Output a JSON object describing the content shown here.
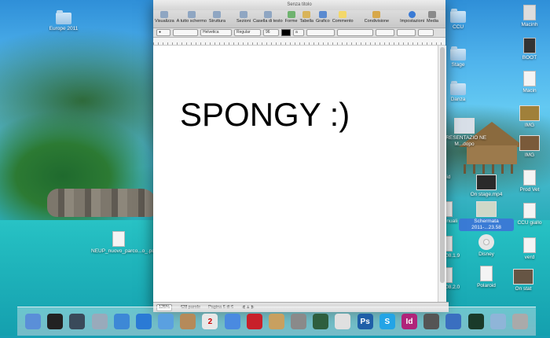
{
  "desktop": {
    "icons_left": [
      {
        "label": "Europe 2011"
      },
      {
        "label": "NEUP_nuovo_parco...o_.pdf"
      }
    ],
    "icons_right": [
      {
        "label": "CCU"
      },
      {
        "label": "Stage"
      },
      {
        "label": "Danza"
      },
      {
        "label": "PRESENTAZIO NE M...dopo"
      },
      {
        "label": "On stage.mp4"
      },
      {
        "label": "Schermata 2011-...23.58"
      },
      {
        "label": "Disney"
      },
      {
        "label": "Polaroid"
      },
      {
        "label": "On stat"
      },
      {
        "label": "Macinh"
      },
      {
        "label": "BOOT"
      },
      {
        "label": "Macin"
      },
      {
        "label": "IMG"
      },
      {
        "label": "IMG"
      },
      {
        "label": "Prod Vet"
      },
      {
        "label": "CCU giallo"
      },
      {
        "label": "verd"
      },
      {
        "label": "roid"
      },
      {
        "label": "mon nuali"
      },
      {
        "label": "mata 08.1.9"
      },
      {
        "label": "mata 08.2.0"
      }
    ]
  },
  "window": {
    "title": "Senza titolo",
    "toolbar": [
      {
        "label": "Visualizza",
        "icon": "view-icon"
      },
      {
        "label": "A tutto schermo",
        "icon": "fullscreen-icon"
      },
      {
        "label": "Struttura",
        "icon": "structure-icon"
      },
      {
        "label": "Sezioni",
        "icon": "sections-icon"
      },
      {
        "label": "Casella di testo",
        "icon": "textbox-icon"
      },
      {
        "label": "Forme",
        "icon": "shapes-icon"
      },
      {
        "label": "Tabella",
        "icon": "table-icon"
      },
      {
        "label": "Grafico",
        "icon": "chart-icon"
      },
      {
        "label": "Commento",
        "icon": "comment-icon"
      },
      {
        "label": "Condivisione",
        "icon": "share-icon"
      },
      {
        "label": "Impostazioni",
        "icon": "info-icon"
      },
      {
        "label": "Media",
        "icon": "media-icon"
      }
    ],
    "format": {
      "font": "Helvetica",
      "style": "Regular",
      "size": "96",
      "spacing": "a"
    },
    "document_text": "SPONGY :)",
    "status": {
      "zoom": "125%",
      "words": "428 parole",
      "page": "Pagina 6 di 6"
    }
  },
  "dock": [
    {
      "name": "finder",
      "color": "#5a8fd8",
      "glyph": ""
    },
    {
      "name": "dashboard",
      "color": "#222",
      "glyph": ""
    },
    {
      "name": "time-machine",
      "color": "#3a4a5a",
      "glyph": ""
    },
    {
      "name": "preview",
      "color": "#9ab",
      "glyph": ""
    },
    {
      "name": "safari",
      "color": "#3d88d6",
      "glyph": ""
    },
    {
      "name": "app-store",
      "color": "#2a7ad5",
      "glyph": ""
    },
    {
      "name": "facetime",
      "color": "#5aa0e0",
      "glyph": ""
    },
    {
      "name": "address-book",
      "color": "#b58a5a",
      "glyph": ""
    },
    {
      "name": "ical",
      "color": "#e8e8e8",
      "glyph": "2"
    },
    {
      "name": "itunes",
      "color": "#4a8ae0",
      "glyph": ""
    },
    {
      "name": "photo-booth",
      "color": "#c8202a",
      "glyph": ""
    },
    {
      "name": "iphoto",
      "color": "#c8a060",
      "glyph": ""
    },
    {
      "name": "system-preferences",
      "color": "#8a8a8a",
      "glyph": ""
    },
    {
      "name": "time-machine-2",
      "color": "#2e5e3e",
      "glyph": ""
    },
    {
      "name": "pages",
      "color": "#e0e0e0",
      "glyph": ""
    },
    {
      "name": "photoshop",
      "color": "#1f5fa8",
      "glyph": "Ps"
    },
    {
      "name": "skype",
      "color": "#23a4e6",
      "glyph": "S"
    },
    {
      "name": "indesign",
      "color": "#b0237a",
      "glyph": "Id"
    },
    {
      "name": "migration-assistant",
      "color": "#555",
      "glyph": ""
    },
    {
      "name": "xcode",
      "color": "#3a6fc0",
      "glyph": ""
    },
    {
      "name": "activity-monitor",
      "color": "#1a3a2a",
      "glyph": ""
    },
    {
      "name": "downloads-stack",
      "color": "#8fb5d8",
      "glyph": ""
    },
    {
      "name": "trash",
      "color": "#aaa",
      "glyph": ""
    }
  ]
}
